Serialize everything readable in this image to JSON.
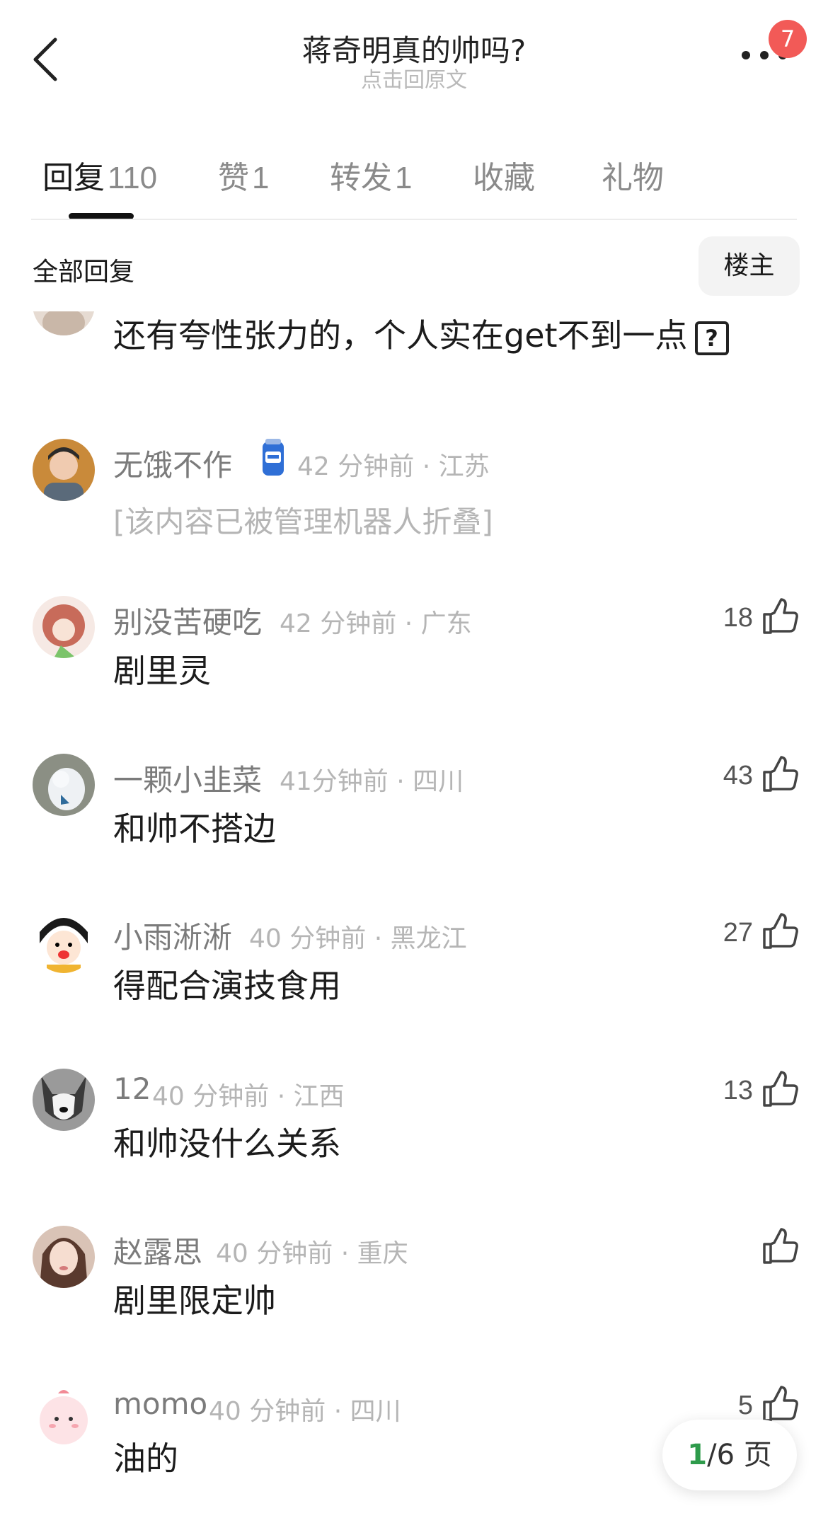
{
  "header": {
    "title": "蒋奇明真的帅吗?",
    "subtitle": "点击回原文",
    "notification_count": "7"
  },
  "tabs": [
    {
      "label": "回复",
      "count": "110"
    },
    {
      "label": "赞",
      "count": "1"
    },
    {
      "label": "转发",
      "count": "1"
    },
    {
      "label": "收藏",
      "count": ""
    },
    {
      "label": "礼物",
      "count": ""
    }
  ],
  "filter": {
    "label": "全部回复",
    "op_button": "楼主"
  },
  "comments": [
    {
      "name": "",
      "meta": "",
      "text": "还有夸性张力的，个人实在get不到一点",
      "likes": ""
    },
    {
      "name": "无饿不作",
      "meta": "42 分钟前 · 江苏",
      "text": "[该内容已被管理机器人折叠]",
      "likes": ""
    },
    {
      "name": "别没苦硬吃",
      "meta": "42 分钟前 · 广东",
      "text": "剧里灵",
      "likes": "18"
    },
    {
      "name": "一颗小韭菜",
      "meta": "41分钟前 · 四川",
      "text": "和帅不搭边",
      "likes": "43"
    },
    {
      "name": "小雨淅淅",
      "meta": "40 分钟前 · 黑龙江",
      "text": "得配合演技食用",
      "likes": "27"
    },
    {
      "name": "12",
      "meta": "40 分钟前 · 江西",
      "text": "和帅没什么关系",
      "likes": "13"
    },
    {
      "name": "赵露思",
      "meta": "40 分钟前 · 重庆",
      "text": "剧里限定帅",
      "likes": ""
    },
    {
      "name": "momo",
      "meta": "40 分钟前 · 四川",
      "text": "油的",
      "likes": "5"
    }
  ],
  "pager": {
    "current": "1",
    "total": "/6 页"
  },
  "icons": {
    "back": "chevron-left-icon",
    "more": "ellipsis-icon",
    "like": "thumbs-up-icon",
    "badge": "blue-can-badge-icon"
  },
  "colors": {
    "notification": "#f25a57",
    "pager_current": "#2e9b4b"
  }
}
